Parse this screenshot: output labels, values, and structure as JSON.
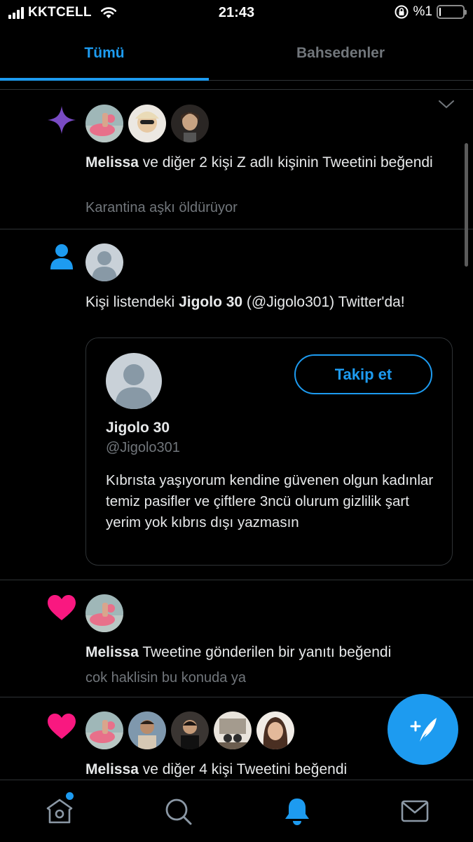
{
  "status_bar": {
    "carrier": "KKTCELL",
    "time": "21:43",
    "battery_text": "%1",
    "battery_level": 0.01
  },
  "tabs": [
    {
      "label": "Tümü",
      "active": true
    },
    {
      "label": "Bahsedenler",
      "active": false
    }
  ],
  "notifications": [
    {
      "icon": "sparkle-icon",
      "icon_color": "#794bc4",
      "actor": "Melissa",
      "text": " ve diğer 2 kişi Z adlı kişinin Tweetini beğendi",
      "sub": "Karantina aşkı öldürüyor"
    },
    {
      "icon": "person-icon",
      "icon_color": "#1d9bf0",
      "text_before": "Kişi listendeki ",
      "actor": "Jigolo 30",
      "text_after": " (@Jigolo301) Twitter'da!",
      "card": {
        "name": "Jigolo 30",
        "handle": "@Jigolo301",
        "follow_label": "Takip et",
        "bio": "Kıbrısta yaşıyorum kendine güvenen olgun kadınlar temiz pasifler ve çiftlere 3ncü olurum gizlilik şart yerim yok kıbrıs dışı yazmasın"
      }
    },
    {
      "icon": "heart-icon",
      "icon_color": "#f91880",
      "actor": "Melissa",
      "text": " Tweetine gönderilen bir yanıtı beğendi",
      "sub": "cok haklisin bu konuda ya"
    },
    {
      "icon": "heart-icon",
      "icon_color": "#f91880",
      "actor": "Melissa",
      "text": " ve diğer 4 kişi Tweetini beğendi"
    }
  ],
  "colors": {
    "accent": "#1d9bf0",
    "background": "#000000",
    "muted_text": "#71767b",
    "divider": "#2f3336"
  },
  "bottom_nav": [
    {
      "icon": "home-icon",
      "has_badge": true
    },
    {
      "icon": "search-icon"
    },
    {
      "icon": "bell-icon",
      "active": true
    },
    {
      "icon": "mail-icon"
    }
  ],
  "fab": {
    "icon": "compose-tweet-icon"
  }
}
